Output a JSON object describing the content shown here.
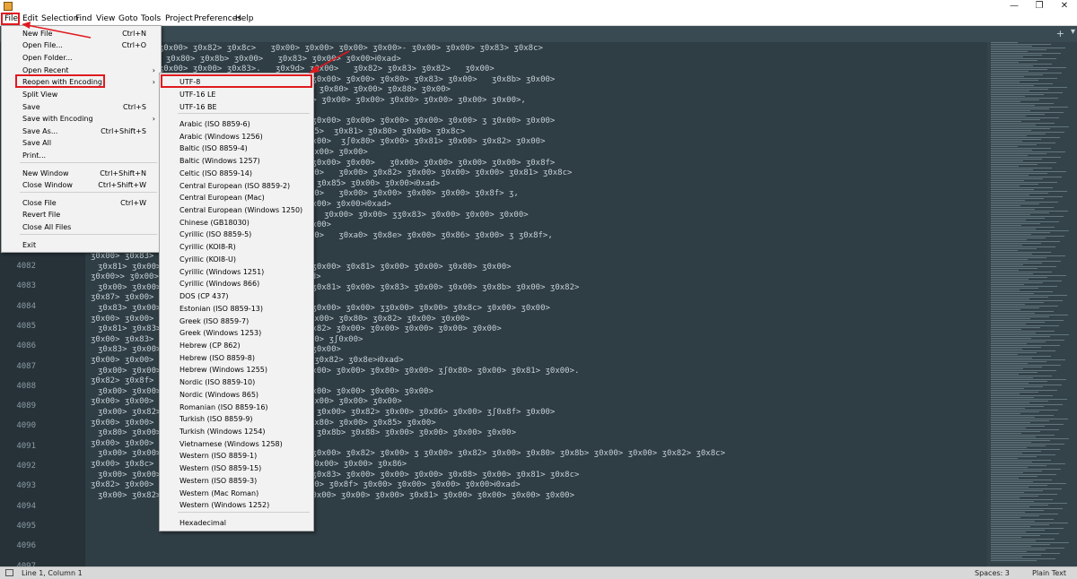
{
  "window": {
    "minimize": "—",
    "maximize": "❐",
    "close": "✕"
  },
  "menubar": [
    "File",
    "Edit",
    "Selection",
    "Find",
    "View",
    "Goto",
    "Tools",
    "Project",
    "Preferences",
    "Help"
  ],
  "tabs": {
    "add": "+",
    "menu": "▾"
  },
  "file_menu": [
    {
      "label": "New File",
      "shortcut": "Ctrl+N"
    },
    {
      "label": "Open File...",
      "shortcut": "Ctrl+O"
    },
    {
      "label": "Open Folder...",
      "shortcut": ""
    },
    {
      "label": "Open Recent",
      "shortcut": "",
      "submenu": true
    },
    {
      "label": "Reopen with Encoding",
      "shortcut": "",
      "submenu": true
    },
    {
      "label": "Split View",
      "shortcut": ""
    },
    {
      "label": "Save",
      "shortcut": "Ctrl+S"
    },
    {
      "label": "Save with Encoding",
      "shortcut": "",
      "submenu": true
    },
    {
      "label": "Save As...",
      "shortcut": "Ctrl+Shift+S"
    },
    {
      "label": "Save All",
      "shortcut": ""
    },
    {
      "label": "Print...",
      "shortcut": ""
    },
    {
      "label": "New Window",
      "shortcut": "Ctrl+Shift+N"
    },
    {
      "label": "Close Window",
      "shortcut": "Ctrl+Shift+W"
    },
    {
      "label": "Close File",
      "shortcut": "Ctrl+W"
    },
    {
      "label": "Revert File",
      "shortcut": ""
    },
    {
      "label": "Close All Files",
      "shortcut": ""
    },
    {
      "label": "Exit",
      "shortcut": ""
    }
  ],
  "encoding_menu": [
    "UTF-8",
    "UTF-16 LE",
    "UTF-16 BE",
    "Arabic (ISO 8859-6)",
    "Arabic (Windows 1256)",
    "Baltic (ISO 8859-4)",
    "Baltic (Windows 1257)",
    "Celtic (ISO 8859-14)",
    "Central European (ISO 8859-2)",
    "Central European (Mac)",
    "Central European (Windows 1250)",
    "Chinese (GB18030)",
    "Cyrillic (ISO 8859-5)",
    "Cyrillic (KOI8-R)",
    "Cyrillic (KOI8-U)",
    "Cyrillic (Windows 1251)",
    "Cyrillic (Windows 866)",
    "DOS (CP 437)",
    "Estonian (ISO 8859-13)",
    "Greek (ISO 8859-7)",
    "Greek (Windows 1253)",
    "Hebrew (CP 862)",
    "Hebrew (ISO 8859-8)",
    "Hebrew (Windows 1255)",
    "Nordic (ISO 8859-10)",
    "Nordic (Windows 865)",
    "Romanian (ISO 8859-16)",
    "Turkish (ISO 8859-9)",
    "Turkish (Windows 1254)",
    "Vietnamese (Windows 1258)",
    "Western (ISO 8859-1)",
    "Western (ISO 8859-15)",
    "Western (ISO 8859-3)",
    "Western (Mac Roman)",
    "Western (Windows 1252)",
    "Hexadecimal"
  ],
  "line_numbers": [
    "4082",
    "4083",
    "4084",
    "4085",
    "4086",
    "4087",
    "4088",
    "4089",
    "4090",
    "4091",
    "4092",
    "4093",
    "4094",
    "4095",
    "4096",
    "4097"
  ],
  "code_lines": [
    "ʒ0x00> ʒ0x00> ʒ0x00> ʒ0x82> ʒ0x8c>   ʒ0x00> ʒ0x00> ʒ0x00> ʒ0x00>- ʒ0x00> ʒ0x00> ʒ0x83> ʒ0x8c>",
    "ʒ0x82> ʒ0x00> ʒ0x80> ʒ0x8b> ʒ0x00>   ʒ0x83> ʒ0x00> ʒ0x00>Ꭵ0xad>",
    "ʒ0x00> ʒ0x00> ʒ0x00> ʒ0x00> ʒ0x83>.   ʒ0x9d> ʒ0x00>   ʒ0x82> ʒ0x83> ʒ0x82>   ʒ0x00>",
    "ʒ0x80> ʒ0x00> ʒ0x81> ʒ0x83> ʒ0x81> ʒ0x8f>,  ʒ0x00> ʒ0x00> ʒ0x80> ʒ0x83> ʒ0x00>   ʒ0x8b> ʒ0x00>",
    "ʒ0x8c> ʒ0x80> ʒ0x00>.   ʒ0x9e> ʒ0x00>   ʒ0x85> ʒ0x80> ʒ0x00> ʒ0x88> ʒ0x00>",
    "ʒ0x00> ʒ0x00> ʒ0x81> ʒ0x00> ʒ0x83> ʒ  ʒʃ0x00> ʒ0x00> ʒ0x00> ʒ0x80> ʒ0x00> ʒ0x00> ʒ0x00>,",
    "ʒ0x88> ʒ0x00> ʒ0x81> ʒ0x82> ʒ0x00>",
    "ʒ0x00> ʒ0x00> ʒ0x00> ʒ0x82> ʒ0x8f> ʒ0x85>,  ʒ0x00> ʒ0x00> ʒ0x00> ʒ0x00> ʒ0x00> ʒ ʒ0x00> ʒ0x00>",
    "ʒ0x80> ʒ0x86> ʒ0x00> ʒ0x8e> ʒ0x89> ʒ0x00> ʒ0x85>  ʒ0x81> ʒ0x80> ʒ0x00> ʒ0x8c>",
    "ʒ0x00> ʒ0x00> ʒ0x00> ʒ0x00> ʒ0x88> ʒ0x00> ʒ0x00>  ʒʃ0x80> ʒ0x00> ʒ0x81> ʒ0x00> ʒ0x82> ʒ0x00>",
    "ʒ0x81> ʒ0x82> ʒ0x80> ʒ0x00> ʒ0x85> ʒ0x00>   ʒ0x00> ʒ0x00>",
    "ʒ0x00> ʒ0x00> ʒ0x87> ʒ0x00> ʒ0x82> ʒ0x8c>,  ʒ0x00> ʒ0x00>   ʒ0x00> ʒ0x00> ʒ0x00> ʒ0x00> ʒ0x8f>",
    "ʒ0x81> ʒ0x00> ʒ0x00> ʒ0x00> ʒ0x00> ʒ0x00> ʒ0x00>   ʒ0x00> ʒ0x82> ʒ0x00> ʒ0x00> ʒ0x00> ʒ0x81> ʒ0x8c>",
    "ʒ0x00> ʒ0x83> ʒ0x00> ʒ0x00> ʒ0x00>,  ʒʃ0x00> ʒ0x85> ʒ0x00> ʒ0x00>Ꭵ0xad>",
    "ʒ0x00> ʒ0x00> ʒ0x86> ʒ0x00> ʒ0x83> ʒ0x00> ʒ0x00>   ʒ0x00> ʒ0x00> ʒ0x00> ʒ0x00> ʒ0x8f> ʒ,",
    "ʒ0x00> ʒ0x00> ʒ0x00> ʒ0x00> ʒ0x00> ʒ0x00> ʒ0x00> ʒ0x00>Ꭵ0xad>",
    "ʒ,  ʒ0x87> ʒ0x82> ʒ0x00> ʒ0x00> ʒ0x00> ʒ0x00>   ʒ0x00> ʒ0x00> ʒʒ0x83> ʒ0x00> ʒ0x00> ʒ0x00>",
    "ʒ0x82> ʒ0x00> ʒ0x00> ʒ0x81> ʒ0x00> ʒ0x00> ʒ0x00>",
    "ʒ0x00> ʒ0x00> ʒ0x00> ʒ0x00> ʒ0x81> ʒ0x82> ʒ0x00>   ʒ0xa0> ʒ0x8e> ʒ0x00> ʒ0x86> ʒ0x00> ʒ ʒ0x8f>,",
    "ʒ0x00> ʒ0x88> ʒ0x00> ʒ   ʒ0x00> ʒ0x00>Ꭵ0xad>",
    "ʒ0x00> ʒ0x83> ʒ0x00> ʒ0x81>,",
    "ʒ0x81> ʒ0x00> ʒ0x00> ʒ0x00> ʒ0x00>   ʒ0x87> ʒ0x00> ʒ0x81> ʒ0x00> ʒ0x00> ʒ0x80> ʒ0x00>",
    "ʒ0x00>> ʒ0x00> ʒ0x83> ʒ0x00> ʒ0x00> ʒ0x81>Ꭵ0xad>",
    "ʒ0x00> ʒ0x00> ʒ0x00> ʒ0x00> ʒ0x00> ʒ0x00>   ʒ0x81> ʒ0x00> ʒ0x83> ʒ0x00> ʒ0x00> ʒ0x8b> ʒ0x00> ʒ0x82>",
    "ʒ0x87> ʒ0x00> ʒ0x80> ʒ0x00>",
    "ʒ0x83> ʒ0x00> ʒ0x82> ʒ0x80> ʒ0x83> ʒ0x00>   ʒ0x00> ʒ0x00> ʒʒ0x00> ʒ0x00> ʒ0x8c> ʒ0x00> ʒ0x00>",
    "ʒ0x00> ʒ0x00> ʒ0x00> ʒ0x80> ʒ0x80> ʒ0x00>   ʒ0x00> ʒ0x80> ʒ0x82> ʒ0x00> ʒ0x00>",
    "ʒ0x81> ʒ0x83> ʒ0x89> ʒ0x00> ʒ0x00> ʒ0x81> ʒ0x82> ʒ0x00> ʒ0x00> ʒ0x00> ʒ0x00> ʒ0x00>",
    "ʒ0x00> ʒ0x83> ʒ0x00> ʒ0x00> ʒ0x00> ʒ0x89> ʒ0x00> ʒʃ0x00>",
    "ʒ0x83> ʒ0x00>   ʒ0x81> ʒ0x00> ʒ0x81> ʒ0x00> ʒ0x00>",
    "ʒ0x00> ʒ0x00> ʒ0x80> ʒ0x81> ʒ0x00> ʒ0x00> ʒ   ʒ0x82> ʒ0x8e>Ꭵ0xad>",
    "ʒ0x00> ʒ0x00> ʒ0x8e> ʒ0x82> ʒ0x8a> ʒ0x00> ʒ0x00> ʒ0x00> ʒ0x80> ʒ0x00> ʒʃ0x80> ʒ0x00> ʒ0x81> ʒ0x00>.",
    "ʒ0x82> ʒ0x8f> ʒ0x00> ʒ0x83>Ꭵ0xad>",
    "ʒ0x00> ʒ0x00> ʒ0x00> ʒ0x00> ʒ0x00> ʒ0x00> ʒ0x00> ʒ0x00> ʒ0x00> ʒ0x00>",
    "ʒ0x00> ʒ0x00> ʒ0x00>:  ʒ0x00> ʒ0x00> ʒ0x00> ʒ0x00> ʒ0x00> ʒ0x00>",
    "ʒ0x00> ʒ0x82> ʒ0x8c>,   ʒ0x80> ʒ0x00> ʒ0x00> ʒ0x00> ʒ0x82> ʒ0x00> ʒ0x86> ʒ0x00> ʒʃ0x8f> ʒ0x00>",
    "ʒ0x00> ʒ0x00> ʒ0x83>,  ʒ0x00> ʒ0x81> ʒ0x82> ʒ0x80> ʒ0x00> ʒ0x85> ʒ0x00>",
    "ʒ0x80> ʒ0x00> ʒ0x00> ʒ0x00>.   ʒ0x00> ʒ0x00> ʒ0x8b> ʒ0x88> ʒ0x00> ʒ0x00> ʒ0x00> ʒ0x00>",
    "ʒ0x00> ʒ0x00> ʒ0x00> ʒ0x00> ʒ0x81>",
    "ʒ0x00> ʒ0x00> ʒ0x00> ʒ0x00> ʒ0x00>   ʒ0x85> ʒ0x00> ʒ0x82> ʒ0x00> ʒ ʒ0x00> ʒ0x82> ʒ0x00> ʒ0x80> ʒ0x8b> ʒ0x00> ʒ0x00> ʒ0x82> ʒ0x8c>",
    "ʒ0x00> ʒ0x8c> ʒ0x00> ʒ0x8b>.   ʒ0x9d> ʒ0x00> ʒ0x00> ʒ0x00> ʒ0x86>",
    "ʒ0x00> ʒ0x00> ʒ0x89> ʒ0x00> ʒ0x00>   ʒ0x80> ʒ0x83> ʒ0x00> ʒ0x00> ʒ0x00> ʒ0x88> ʒ0x00> ʒ0x81> ʒ0x8c>",
    "ʒ0x82> ʒ0x00> ʒ0x00> ʒ0x00> ʒ0x00> ʒ0x00> ʒ0x00> ʒ0x8f> ʒ0x00> ʒ0x00> ʒ0x00> ʒ0x00>Ꭵ0xad>",
    "ʒ0x00> ʒ0x82> ʒʃ0x00> ʒ0x00> ʒ0x00> ʒ0x00> ʒ0x00> ʒ0x00> ʒ0x00> ʒ0x81> ʒ0x00> ʒ0x00> ʒ0x00> ʒ0x00>"
  ],
  "status": {
    "position": "Line 1, Column 1",
    "spaces": "Spaces: 3",
    "syntax": "Plain Text"
  },
  "colors": {
    "highlight": "#e0191f",
    "editor_bg": "#2f3d44"
  }
}
